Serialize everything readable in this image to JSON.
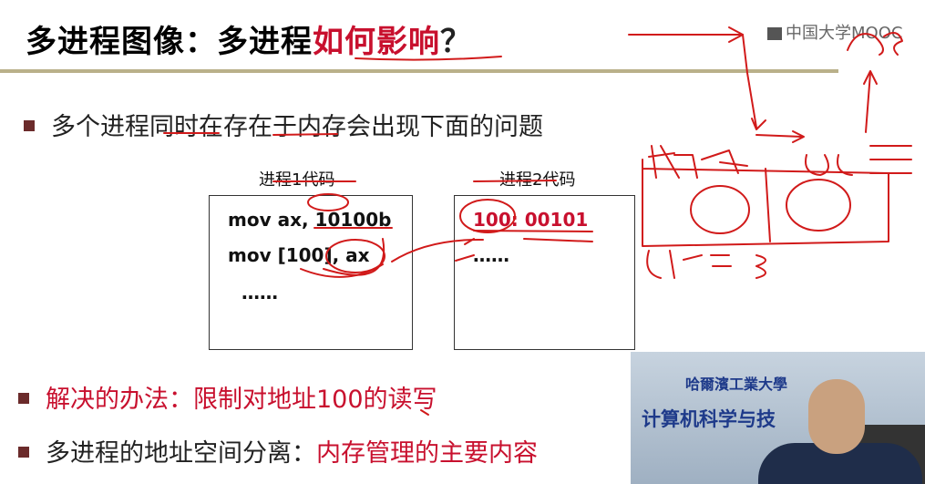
{
  "slide": {
    "title_black": "多进程图像：多进程",
    "title_red": "如何影响",
    "title_mark": "？",
    "logo_text": "中国大学MOOC",
    "bullet1": "多个进程同时在存在于内存会出现下面的问题",
    "caption1": "进程1代码",
    "caption2": "进程2代码",
    "code1": [
      "mov ax, 10100b",
      "mov [100], ax",
      "……"
    ],
    "code2_line1": "100: 00101",
    "code2_line2": "……",
    "bullet2_label": "解决的办法：",
    "bullet2_value": "限制对地址100的读写",
    "bullet3_label": "多进程的地址空间分离：",
    "bullet3_value": "内存管理的主要内容"
  },
  "video": {
    "line1": "哈爾濱工業大學",
    "line2": "计算机科学与技"
  },
  "colors": {
    "accent_red": "#c8102e",
    "title_bar": "#b9b08a",
    "bullet_square": "#6b2b2b"
  }
}
